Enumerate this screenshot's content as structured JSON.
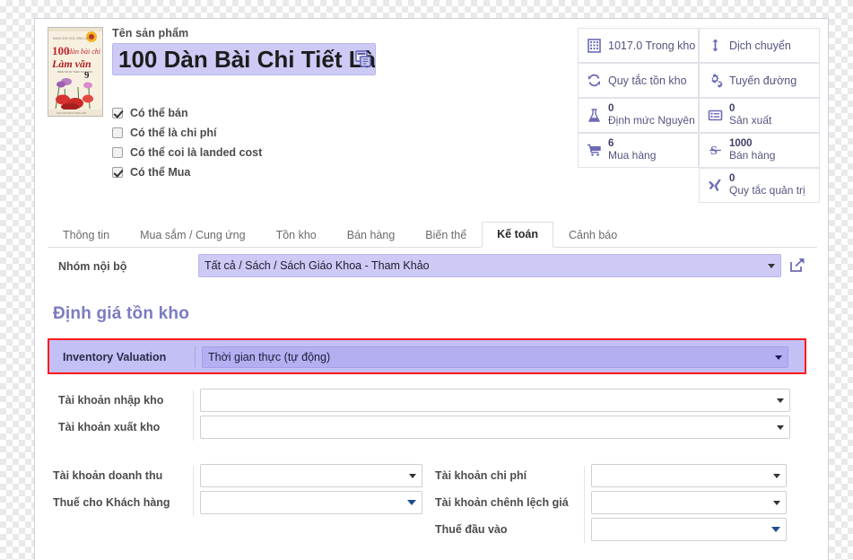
{
  "product": {
    "thumbnail_alt": "book-cover-100-dan-bai-chi-tiet-lam-van-9",
    "name_label": "Tên sản phẩm",
    "name_value": "100 Dàn Bài Chi Tiết Là",
    "copy_icon": "copy-translate-icon",
    "checkboxes": [
      {
        "label": "Có thể bán",
        "checked": true
      },
      {
        "label": "Có thể là chi phí",
        "checked": false
      },
      {
        "label": "Có thể coi là landed cost",
        "checked": false
      },
      {
        "label": "Có thể Mua",
        "checked": true
      }
    ]
  },
  "stats": [
    [
      {
        "icon": "building-icon",
        "value": "1017.0",
        "label": "Trong kho",
        "inline": true
      },
      {
        "icon": "arrows-vertical-icon",
        "value": "",
        "label": "Dịch chuyển",
        "inline": true
      }
    ],
    [
      {
        "icon": "refresh-cycle-icon",
        "value": "",
        "label": "Quy tắc tồn kho",
        "inline": true
      },
      {
        "icon": "gears-icon",
        "value": "",
        "label": "Tuyến đường",
        "inline": true
      }
    ],
    [
      {
        "icon": "flask-icon",
        "value": "0",
        "label": "Định mức Nguyên",
        "inline": false
      },
      {
        "icon": "list-document-icon",
        "value": "0",
        "label": "Sản xuất",
        "inline": false
      }
    ],
    [
      {
        "icon": "shopping-cart-icon",
        "value": "6",
        "label": "Mua hàng",
        "inline": false
      },
      {
        "icon": "sales-s-icon",
        "value": "1000",
        "label": "Bán hàng",
        "inline": false
      }
    ],
    [
      {
        "icon": "xing-rules-icon",
        "value": "0",
        "label": "Quy tắc quản trị",
        "inline": false
      }
    ]
  ],
  "tabs": [
    {
      "label": "Thông tin",
      "active": false
    },
    {
      "label": "Mua sắm / Cung ứng",
      "active": false
    },
    {
      "label": "Tồn kho",
      "active": false
    },
    {
      "label": "Bán hàng",
      "active": false
    },
    {
      "label": "Biến thể",
      "active": false
    },
    {
      "label": "Kế toán",
      "active": true
    },
    {
      "label": "Cảnh báo",
      "active": false
    }
  ],
  "form": {
    "internal_group": {
      "label": "Nhóm nội bộ",
      "value": "Tất cả / Sách / Sách Giáo Khoa - Tham Khảo",
      "share_icon": "external-link-icon"
    },
    "section_title": "Định giá tồn kho",
    "inventory_valuation": {
      "label": "Inventory Valuation",
      "value": "Thời gian thực (tự động)",
      "highlight_color": "#ff1a1a"
    },
    "stock_in_account": {
      "label": "Tài khoản nhập kho",
      "value": ""
    },
    "stock_out_account": {
      "label": "Tài khoản xuất kho",
      "value": ""
    },
    "revenue_account": {
      "label": "Tài khoản doanh thu",
      "value": ""
    },
    "customer_tax": {
      "label": "Thuế cho Khách hàng",
      "value": ""
    },
    "expense_account": {
      "label": "Tài khoản chi phí",
      "value": ""
    },
    "price_difference_account": {
      "label": "Tài khoản chênh lệch giá",
      "value": ""
    },
    "input_tax": {
      "label": "Thuế đầu vào",
      "value": ""
    }
  }
}
